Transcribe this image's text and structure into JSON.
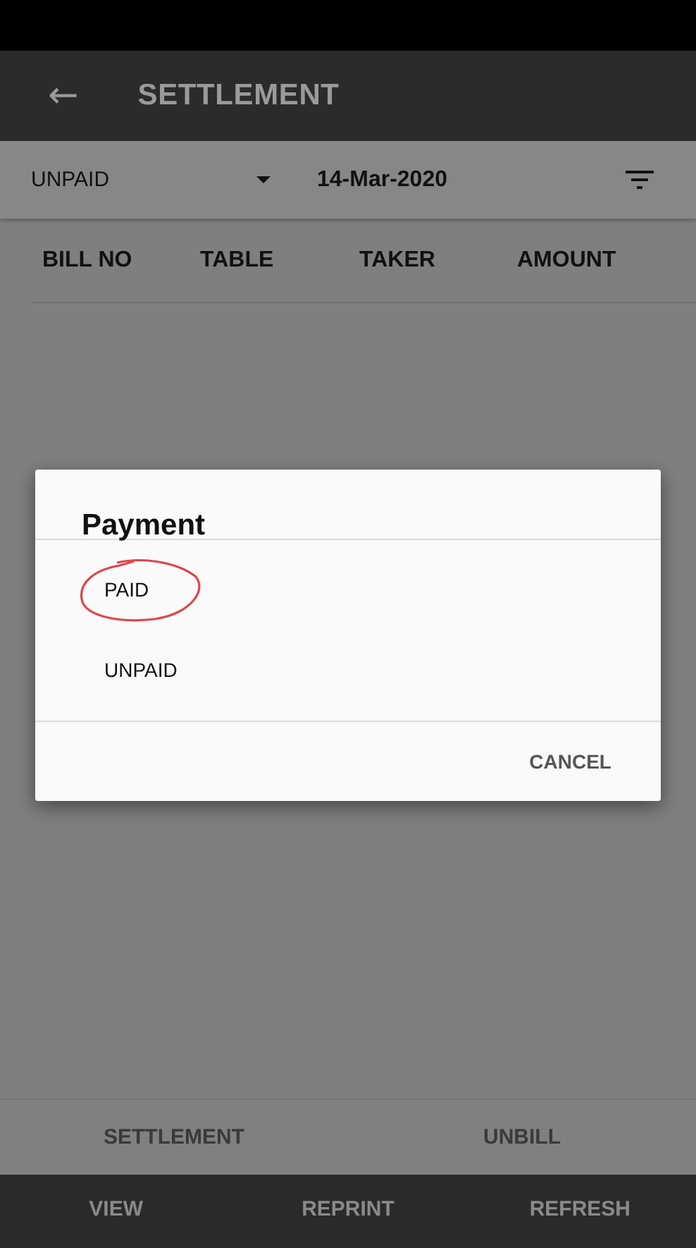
{
  "app_bar": {
    "back_icon": "←",
    "title": "SETTLEMENT"
  },
  "filter": {
    "status": "UNPAID",
    "date": "14-Mar-2020"
  },
  "table": {
    "columns": [
      "BILL NO",
      "TABLE",
      "TAKER",
      "AMOUNT"
    ]
  },
  "tabs": [
    {
      "label": "SETTLEMENT"
    },
    {
      "label": "UNBILL"
    }
  ],
  "bottom_bar": [
    "VIEW",
    "REPRINT",
    "REFRESH"
  ],
  "dialog": {
    "title": "Payment",
    "options": [
      {
        "label": "PAID",
        "circled": true
      },
      {
        "label": "UNPAID",
        "circled": false
      }
    ],
    "buttons": [
      "CANCEL"
    ]
  }
}
